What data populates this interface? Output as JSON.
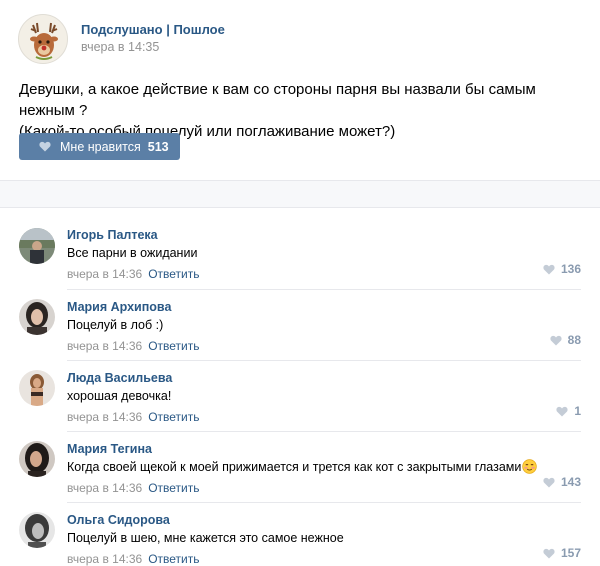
{
  "post": {
    "group_name": "Подслушано | Пошлое",
    "time": "вчера в 14:35",
    "text_line1": "Девушки, а какое действие к вам со стороны парня вы назвали бы самым нежным ?",
    "text_line2": "(Какой-то особый поцелуй или поглаживание может?)",
    "like_label": "Мне нравится",
    "like_count": "513"
  },
  "colors": {
    "link_blue": "#2a5885",
    "like_button": "#5b7fa6",
    "muted_gray": "#939393"
  },
  "icons": {
    "heart": "heart-icon",
    "emoji": "blushing-smile-emoji"
  },
  "comments": [
    {
      "author": "Игорь Палтека",
      "text": "Все парни в ожидании",
      "time": "вчера в 14:36",
      "reply": "Ответить",
      "likes": "136"
    },
    {
      "author": "Мария Архипова",
      "text": "Поцелуй в лоб :)",
      "time": "вчера в 14:36",
      "reply": "Ответить",
      "likes": "88"
    },
    {
      "author": "Люда Васильева",
      "text": "хорошая девочка!",
      "time": "вчера в 14:36",
      "reply": "Ответить",
      "likes": "1"
    },
    {
      "author": "Мария Тегина",
      "text": "Когда своей щекой к моей прижимается и трется как кот с закрытыми глазами",
      "time": "вчера в 14:36",
      "reply": "Ответить",
      "likes": "143"
    },
    {
      "author": "Ольга Сидорова",
      "text": "Поцелуй в шею, мне кажется это самое нежное",
      "time": "вчера в 14:36",
      "reply": "Ответить",
      "likes": "157"
    }
  ]
}
